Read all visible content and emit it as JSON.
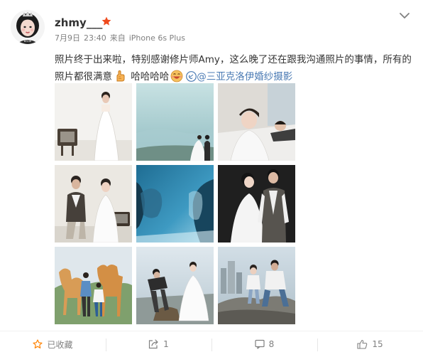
{
  "post": {
    "username": "zhmy___",
    "date": "7月9日",
    "time": "23:40",
    "source_prefix": "来自",
    "source": "iPhone 6s Plus",
    "text_main": "照片终于出来啦，特别感谢修片师Amy，这么晚了还在跟我沟通照片的事情，所有的照片都很满意",
    "text_laugh": "哈哈哈哈",
    "mention_at": "@",
    "mention_name": "三亚克洛伊婚纱摄影",
    "icons": {
      "avatar": "avatar",
      "badge": "star-badge-icon",
      "chevron": "chevron-down-icon",
      "emoji_hand": "pointing-hand-emoji-icon",
      "emoji_face": "laughing-face-emoji-icon",
      "mention": "link-icon"
    }
  },
  "photos": [
    {
      "name": "bride-with-tv",
      "palette": [
        "#f3f3f1",
        "#d9d6d0",
        "#4a4036"
      ]
    },
    {
      "name": "beach-sea",
      "palette": [
        "#bcd7d8",
        "#9cc3c6",
        "#3f5a55"
      ]
    },
    {
      "name": "bride-lying",
      "palette": [
        "#dfdcd8",
        "#c5c1bb",
        "#3b3531"
      ]
    },
    {
      "name": "couple-sitting",
      "palette": [
        "#ebe8e2",
        "#cfcac1",
        "#3a342e"
      ]
    },
    {
      "name": "couple-blue",
      "palette": [
        "#3a8cb2",
        "#1e5876",
        "#bfe1ee"
      ]
    },
    {
      "name": "couple-dark",
      "palette": [
        "#202020",
        "#3b3b3b",
        "#efefef"
      ]
    },
    {
      "name": "camels",
      "palette": [
        "#d9e1e6",
        "#d89c56",
        "#7f9e6d"
      ]
    },
    {
      "name": "couple-beach-rock",
      "palette": [
        "#cdd8de",
        "#8c8f8a",
        "#2d2d2d"
      ]
    },
    {
      "name": "couple-cliff",
      "palette": [
        "#c7d6df",
        "#8a8d86",
        "#2e2d2a"
      ]
    }
  ],
  "footer": {
    "favorite_label": "已收藏",
    "favorite_icon": "star-outline-icon",
    "repost_count": "1",
    "repost_icon": "share-icon",
    "comment_count": "8",
    "comment_icon": "comment-icon",
    "like_count": "15",
    "like_icon": "thumbs-up-icon",
    "accent_color": "#ff8200",
    "text_color": "#808080"
  }
}
